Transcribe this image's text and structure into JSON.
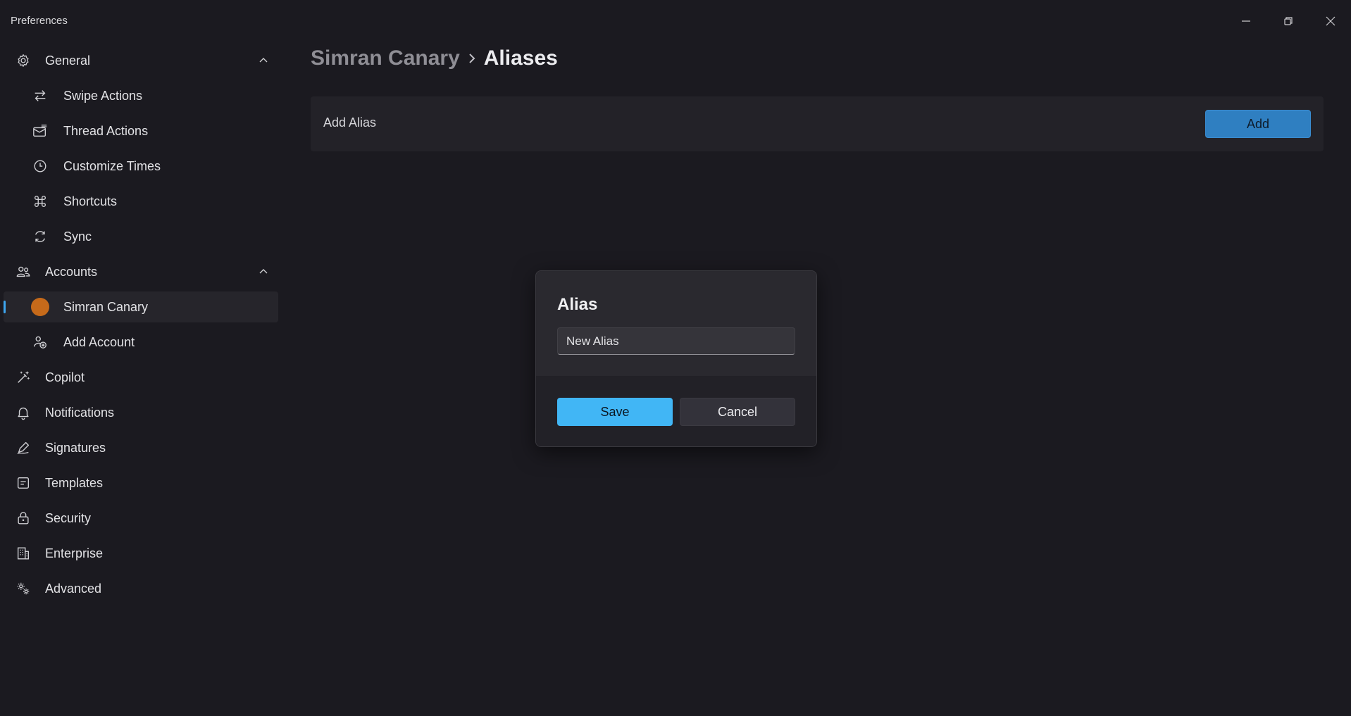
{
  "window": {
    "title": "Preferences",
    "controls": [
      "minimize-icon",
      "restore-icon",
      "close-icon"
    ]
  },
  "sidebar": {
    "items": [
      {
        "label": "General",
        "icon": "gear-icon",
        "level": "top",
        "expanded": true
      },
      {
        "label": "Swipe Actions",
        "icon": "swap-arrows-icon",
        "level": "sub"
      },
      {
        "label": "Thread Actions",
        "icon": "mail-stack-icon",
        "level": "sub"
      },
      {
        "label": "Customize Times",
        "icon": "clock-icon",
        "level": "sub"
      },
      {
        "label": "Shortcuts",
        "icon": "command-key-icon",
        "level": "sub"
      },
      {
        "label": "Sync",
        "icon": "sync-icon",
        "level": "sub"
      },
      {
        "label": "Accounts",
        "icon": "people-icon",
        "level": "top",
        "expanded": true
      },
      {
        "label": "Simran Canary",
        "icon": "avatar",
        "level": "sub",
        "selected": true
      },
      {
        "label": "Add Account",
        "icon": "add-account-icon",
        "level": "sub"
      },
      {
        "label": "Copilot",
        "icon": "magic-wand-icon",
        "level": "top"
      },
      {
        "label": "Notifications",
        "icon": "bell-icon",
        "level": "top"
      },
      {
        "label": "Signatures",
        "icon": "pen-icon",
        "level": "top"
      },
      {
        "label": "Templates",
        "icon": "template-icon",
        "level": "top"
      },
      {
        "label": "Security",
        "icon": "lock-icon",
        "level": "top"
      },
      {
        "label": "Enterprise",
        "icon": "building-icon",
        "level": "top"
      },
      {
        "label": "Advanced",
        "icon": "advanced-gear-icon",
        "level": "top"
      }
    ]
  },
  "breadcrumb": {
    "parent": "Simran Canary",
    "current": "Aliases"
  },
  "add_alias": {
    "label": "Add Alias",
    "button": "Add"
  },
  "dialog": {
    "title": "Alias",
    "input_value": "New Alias",
    "save": "Save",
    "cancel": "Cancel"
  },
  "colors": {
    "background": "#1b1a20",
    "accent": "#41b6f5",
    "add_button": "#2f7fc1",
    "avatar": "#c66a1a",
    "selection_bar": "#3ea6f0"
  }
}
